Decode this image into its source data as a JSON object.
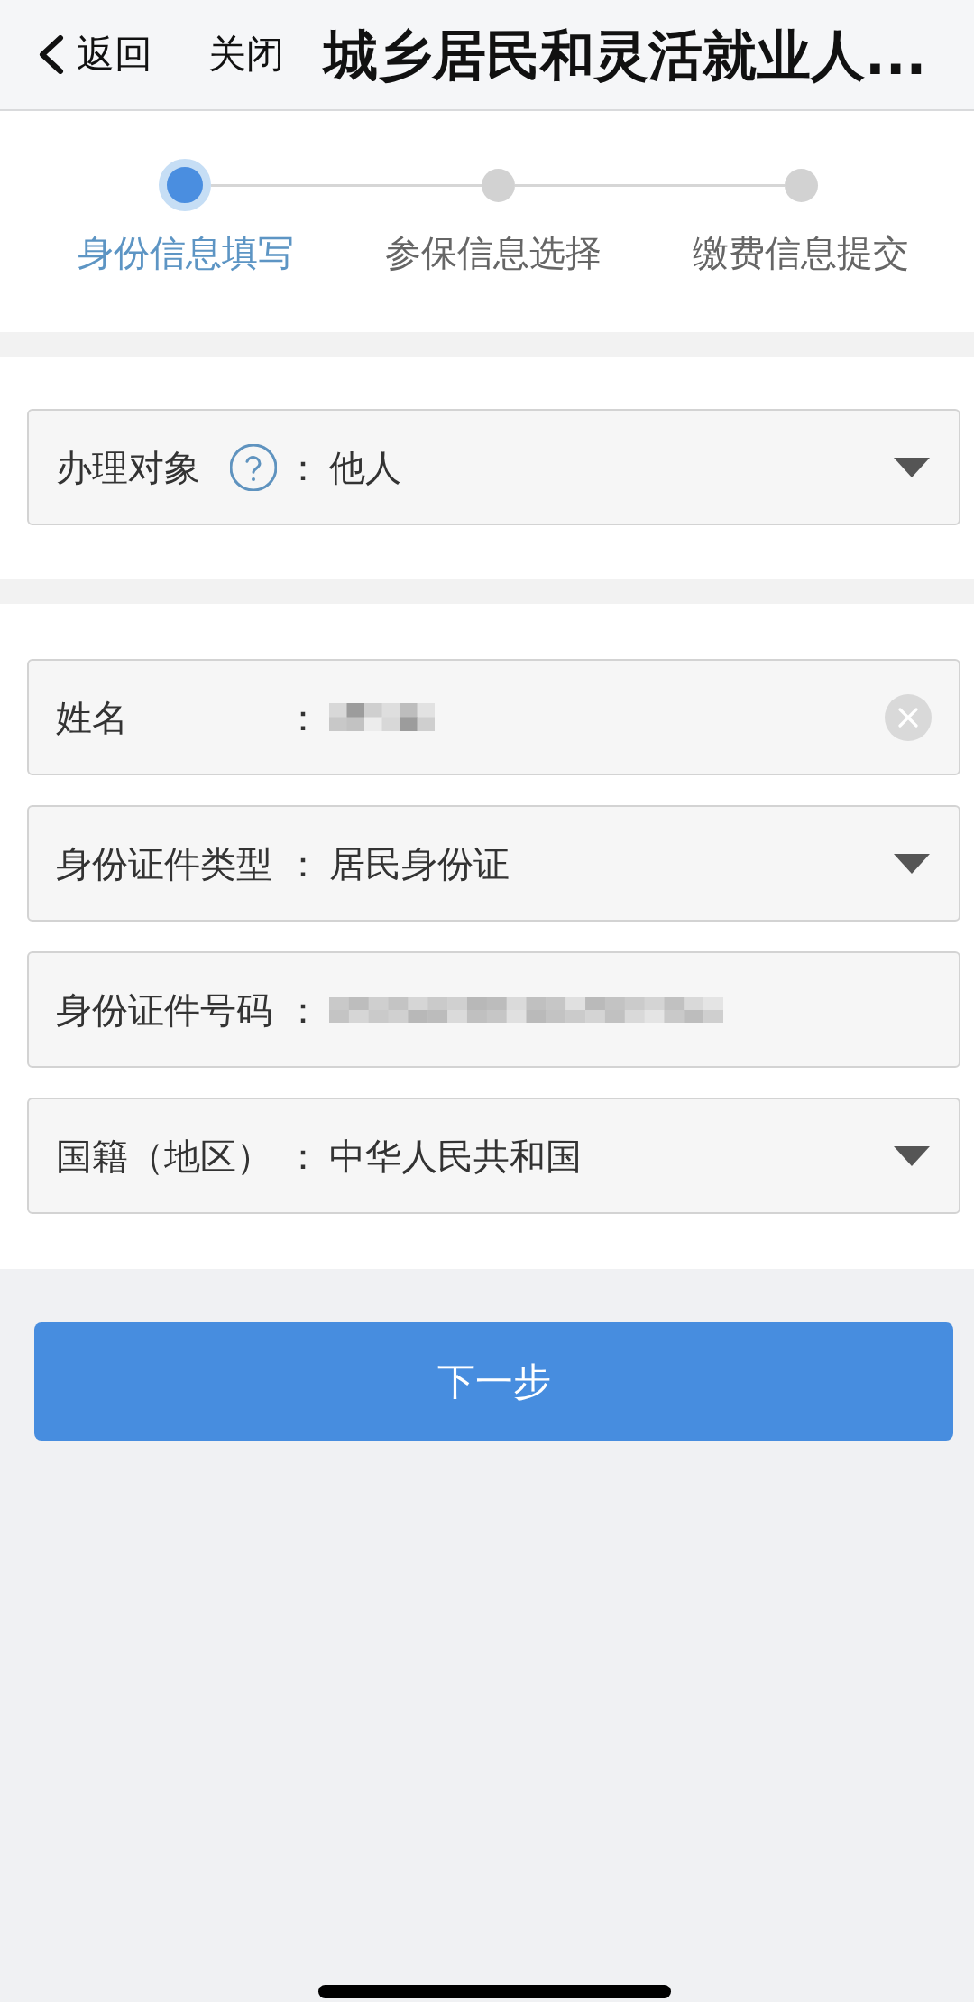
{
  "header": {
    "back_label": "返回",
    "close_label": "关闭",
    "title": "城乡居民和灵活就业人..."
  },
  "steps": [
    {
      "label": "身份信息填写",
      "selected": true
    },
    {
      "label": "参保信息选择",
      "selected": false
    },
    {
      "label": "缴费信息提交",
      "selected": false
    }
  ],
  "sections": [
    {
      "fields": [
        {
          "kind": "select",
          "label": "办理对象",
          "help": true,
          "colon": "：",
          "value": "他人",
          "redacted": false,
          "clearable": false
        }
      ]
    },
    {
      "fields": [
        {
          "kind": "text",
          "label": "姓名",
          "help": false,
          "colon": "：",
          "redacted": true,
          "clearable": true
        },
        {
          "kind": "select",
          "label": "身份证件类型",
          "help": false,
          "colon": "：",
          "value": "居民身份证",
          "redacted": false,
          "clearable": false
        },
        {
          "kind": "text",
          "label": "身份证件号码",
          "help": false,
          "colon": "：",
          "redacted": true,
          "clearable": false
        },
        {
          "kind": "select",
          "label": "国籍（地区）",
          "help": false,
          "colon": "：",
          "value": "中华人民共和国",
          "redacted": false,
          "clearable": false
        }
      ]
    }
  ],
  "next_button": "下一步"
}
